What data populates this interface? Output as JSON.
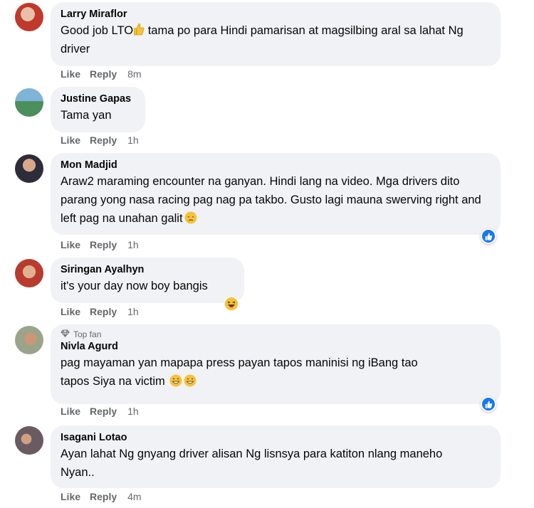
{
  "comments": [
    {
      "author": "Larry Miraflor",
      "text_a": "Good job LTO",
      "text_b": " tama po para Hindi pamarisan at magsilbing aral sa lahat Ng driver",
      "like": "Like",
      "reply": "Reply",
      "time": "8m"
    },
    {
      "author": "Justine Gapas",
      "text": "Tama yan",
      "like": "Like",
      "reply": "Reply",
      "time": "1h"
    },
    {
      "author": "Mon Madjid",
      "text": "Araw2 maraming encounter na ganyan. Hindi lang na video. Mga drivers dito parang yong nasa racing pag nag pa takbo. Gusto lagi mauna swerving right and left pag na unahan galit",
      "like": "Like",
      "reply": "Reply",
      "time": "1h"
    },
    {
      "author": "Siringan Ayalhyn",
      "text": "it's your day now boy bangis",
      "like": "Like",
      "reply": "Reply",
      "time": "1h"
    },
    {
      "badge": "Top fan",
      "author": "Nivla Agurd",
      "text": "pag mayaman yan mapapa press payan tapos maninisi ng iBang tao tapos Siya na victim",
      "like": "Like",
      "reply": "Reply",
      "time": "1h"
    },
    {
      "author": "Isagani Lotao",
      "text": "Ayan lahat Ng gnyang driver alisan Ng lisnsya para katiton nlang maneho Nyan..",
      "like": "Like",
      "reply": "Reply",
      "time": "4m"
    }
  ],
  "colors": {
    "bubble": "#f0f2f5",
    "meta": "#65676b",
    "like_blue": "#1877f2"
  }
}
